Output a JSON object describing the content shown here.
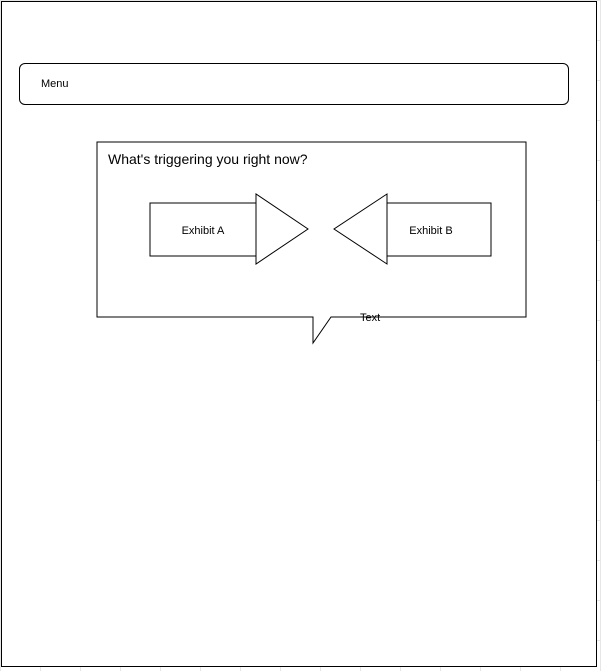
{
  "menu": {
    "label": "Menu"
  },
  "callout": {
    "question": "What's triggering you right now?",
    "tail_text": "Text"
  },
  "exhibits": {
    "a_label": "Exhibit A",
    "b_label": "Exhibit B"
  }
}
